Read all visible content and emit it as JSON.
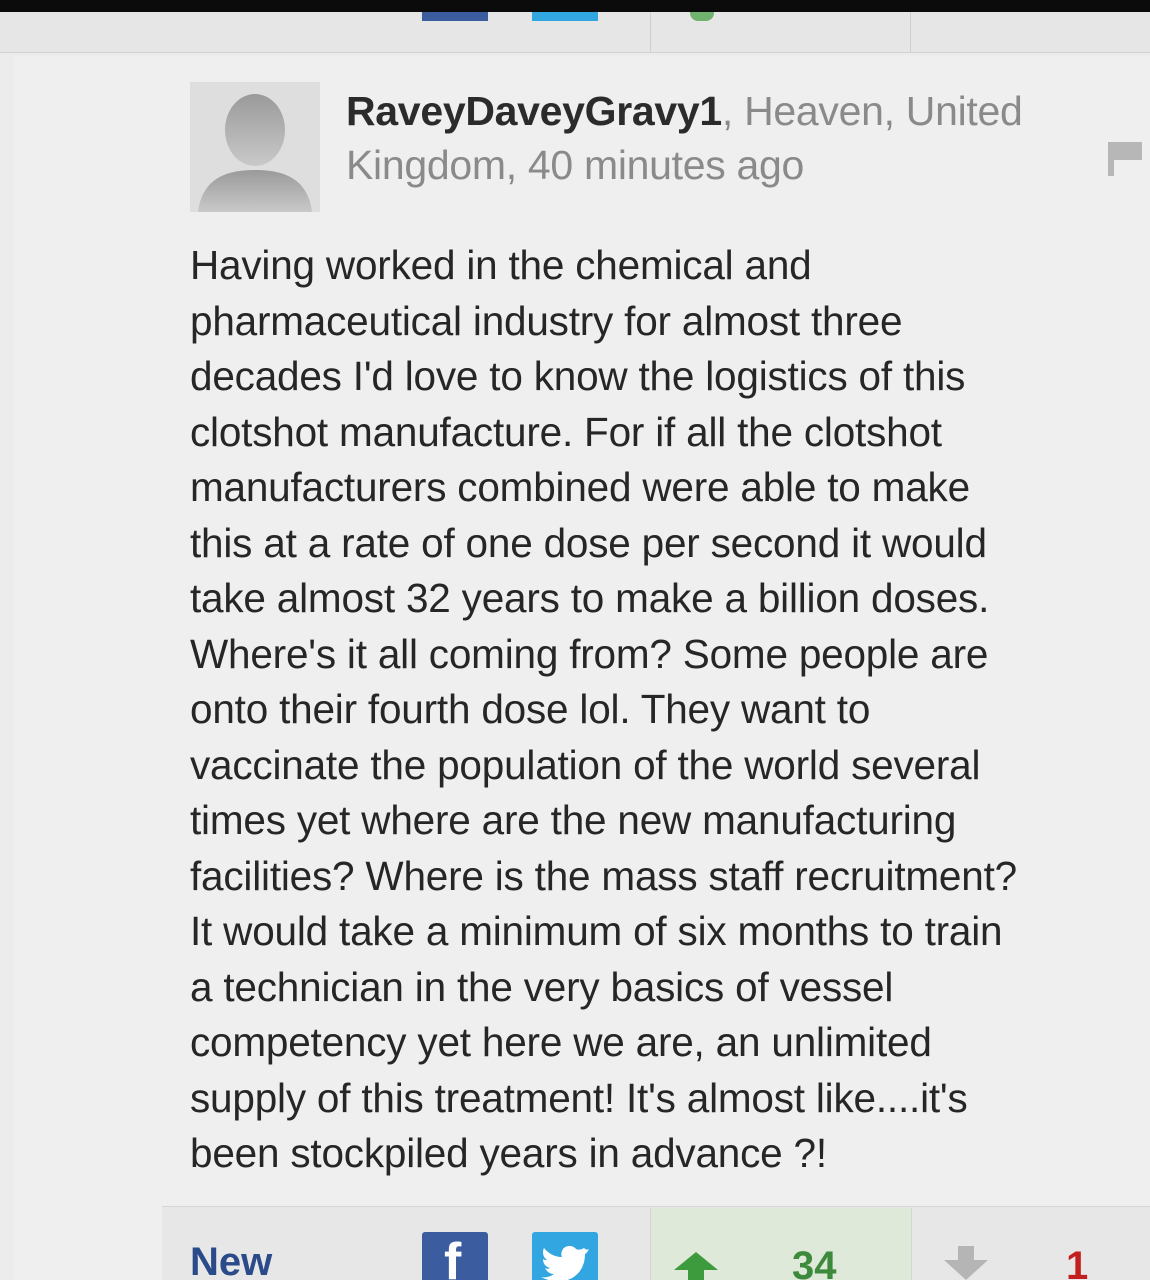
{
  "comment": {
    "username": "RaveyDaveyGravy1",
    "meta_line1": ", Heaven, United",
    "meta_line2": "Kingdom, 40 minutes ago",
    "body": "Having worked in the chemical and\npharmaceutical industry for almost three\ndecades I'd love to know the logistics of this\nclotshot manufacture. For if all the clotshot\nmanufacturers combined were able to make\nthis at a rate of one dose per second it would\ntake almost 32 years to make a billion doses.\nWhere's it all coming from? Some people are\nonto their fourth dose lol. They want to\nvaccinate the population of the world several\ntimes yet where are the new manufacturing\nfacilities? Where is the mass staff recruitment?\nIt would take a minimum of six months to train\na technician in the very basics of vessel\ncompetency yet here we are, an unlimited\nsupply of this treatment! It's almost like....it's\nbeen stockpiled years in advance ?!"
  },
  "actions": {
    "new_label": "New",
    "facebook_glyph": "f",
    "upvotes": "34",
    "downvotes": "1"
  },
  "icons": {
    "avatar": "default-avatar-icon",
    "flag": "flag-icon",
    "facebook": "facebook-icon",
    "twitter": "twitter-icon",
    "up": "arrow-up-icon",
    "down": "arrow-down-icon"
  },
  "colors": {
    "username": "#2b2b2b",
    "meta": "#8a8a8a",
    "body": "#262626",
    "new_link": "#2a4a8a",
    "facebook": "#3b5c9e",
    "twitter": "#32a6e0",
    "upvote": "#3d8a3d",
    "downvote": "#c41f1f",
    "upvote_bg": "#dfe9d9"
  }
}
